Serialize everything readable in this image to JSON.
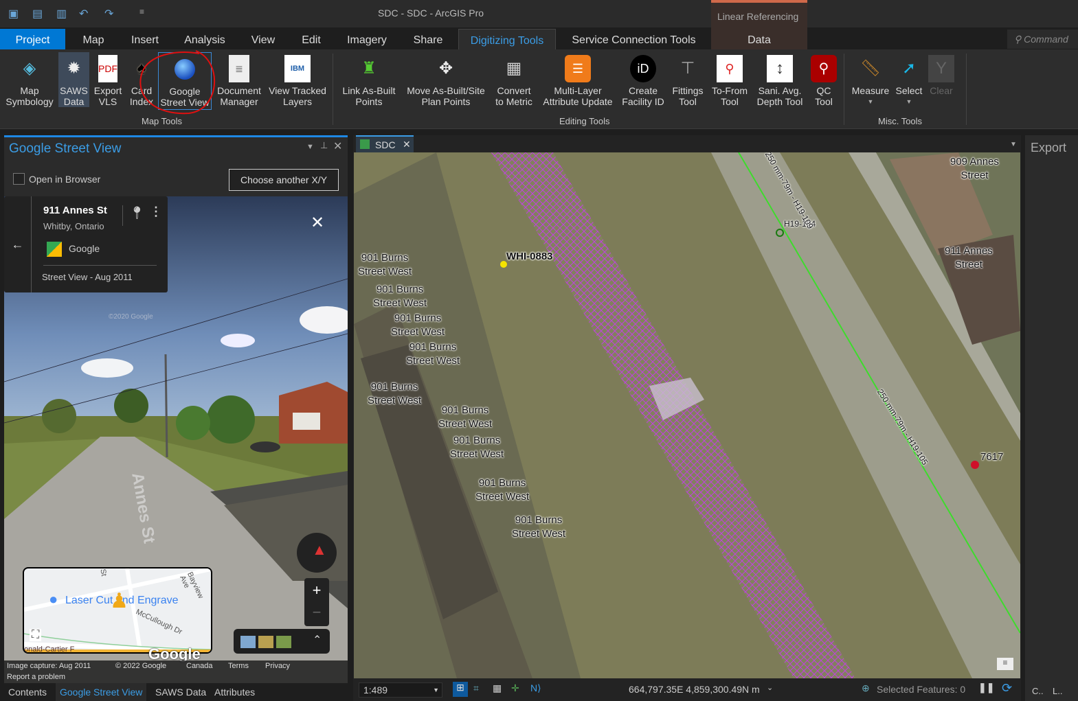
{
  "app": {
    "title": "SDC - SDC - ArcGIS Pro",
    "contextual_group": "Linear Referencing",
    "command_search_placeholder": "Command"
  },
  "tabs": [
    "Project",
    "Map",
    "Insert",
    "Analysis",
    "View",
    "Edit",
    "Imagery",
    "Share",
    "Digitizing Tools",
    "Service Connection Tools",
    "Data"
  ],
  "ribbon": {
    "groups": [
      "Map Tools",
      "Editing Tools",
      "Misc. Tools"
    ],
    "map_tools": [
      [
        "Map",
        "Symbology"
      ],
      [
        "SAWS",
        "Data"
      ],
      [
        "Export",
        "VLS"
      ],
      [
        "Card",
        "Index"
      ],
      [
        "Google",
        "Street View"
      ],
      [
        "Document",
        "Manager"
      ],
      [
        "View Tracked",
        "Layers"
      ]
    ],
    "editing_tools": [
      [
        "Link As-Built",
        "Points"
      ],
      [
        "Move As-Built/Site",
        "Plan Points"
      ],
      [
        "Convert",
        "to Metric"
      ],
      [
        "Multi-Layer",
        "Attribute Update"
      ],
      [
        "Create",
        "Facility ID"
      ],
      [
        "Fittings",
        "Tool"
      ],
      [
        "To-From",
        "Tool"
      ],
      [
        "Sani. Avg.",
        "Depth Tool"
      ],
      [
        "QC",
        "Tool"
      ]
    ],
    "misc_tools": [
      "Measure",
      "Select",
      "Clear"
    ]
  },
  "street_view_pane": {
    "title": "Google Street View",
    "open_in_browser": "Open in Browser",
    "choose_button": "Choose another X/Y",
    "address": "911 Annes St",
    "city": "Whitby, Ontario",
    "provider": "Google",
    "capture": "Street View - Aug 2011",
    "street_sign": "Annes St",
    "watermark": "©2020 Google",
    "minimap": {
      "place": "Laser Cut and Engrave",
      "streets": [
        "Bayview Ave",
        "McCullough Dr",
        "St",
        "onald-Cartier F"
      ]
    },
    "footer": [
      "Image capture: Aug 2011",
      "© 2022 Google",
      "Canada",
      "Terms",
      "Privacy"
    ],
    "report": "Report a problem",
    "logo": "Google"
  },
  "bottom_tabs": [
    "Contents",
    "Google Street View",
    "SAWS Data",
    "Attributes"
  ],
  "map": {
    "tab": "SDC",
    "labels": {
      "whi": "WHI-0883",
      "h19_104": "H19-104",
      "p7617": "7617",
      "pipe1": "250 mm-79m - H19-109",
      "pipe2": "250 mm-79m - H19-105",
      "burns": [
        "901 Burns",
        "Street West"
      ],
      "annes909": [
        "909 Annes",
        "Street"
      ],
      "annes911": [
        "911 Annes",
        "Street"
      ]
    },
    "colors": {
      "pipe": "#3ddc2c",
      "hatch": "#c040e0",
      "point_yellow": "#f5e400",
      "point_red": "#d0102a"
    }
  },
  "status": {
    "scale": "1:489",
    "coords": "664,797.35E 4,859,300.49N m",
    "selected": "Selected Features: 0"
  },
  "export_pane": {
    "title": "Export",
    "bottom": [
      "C..",
      "L.."
    ]
  }
}
